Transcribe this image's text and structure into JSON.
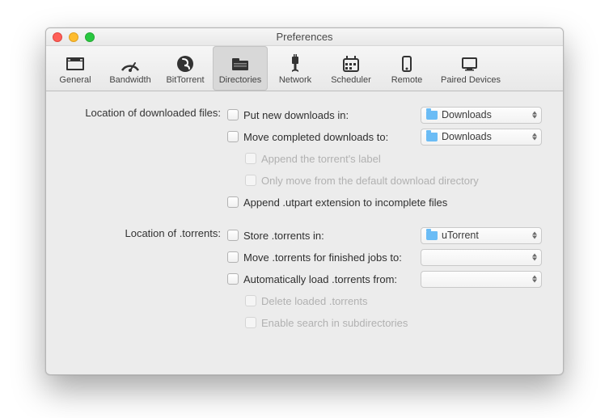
{
  "window": {
    "title": "Preferences"
  },
  "toolbar": {
    "items": [
      {
        "label": "General"
      },
      {
        "label": "Bandwidth"
      },
      {
        "label": "BitTorrent"
      },
      {
        "label": "Directories"
      },
      {
        "label": "Network"
      },
      {
        "label": "Scheduler"
      },
      {
        "label": "Remote"
      },
      {
        "label": "Paired Devices"
      }
    ],
    "active_index": 3
  },
  "sections": {
    "downloads": {
      "label": "Location of downloaded files:",
      "put_new": "Put new downloads in:",
      "put_new_value": "Downloads",
      "move_completed": "Move completed downloads to:",
      "move_completed_value": "Downloads",
      "append_label": "Append the torrent's label",
      "only_move_default": "Only move from the default download directory",
      "append_utpart": "Append .utpart extension to incomplete files"
    },
    "torrents": {
      "label": "Location of .torrents:",
      "store_in": "Store .torrents in:",
      "store_in_value": "uTorrent",
      "move_finished": "Move .torrents for finished jobs to:",
      "move_finished_value": "",
      "auto_load": "Automatically load .torrents from:",
      "auto_load_value": "",
      "delete_loaded": "Delete loaded .torrents",
      "enable_search": "Enable search in subdirectories"
    }
  }
}
